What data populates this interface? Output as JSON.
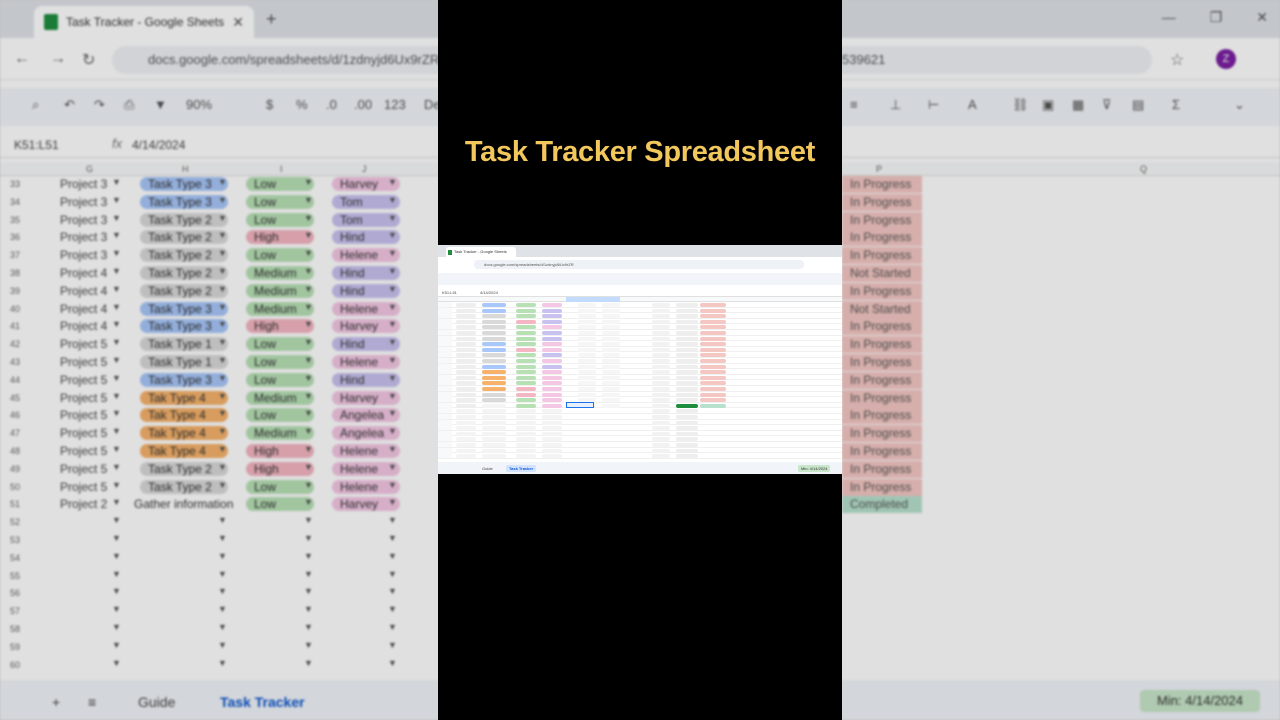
{
  "video": {
    "title": "Task Tracker Spreadsheet"
  },
  "browser": {
    "tab_title": "Task Tracker - Google Sheets",
    "url": "docs.google.com/spreadsheets/d/1zdnyjd6Ux9rZR",
    "url_tail": "539621",
    "profile_initial": "Z"
  },
  "toolbar": {
    "zoom": "90%",
    "currency": "$",
    "percent": "%",
    "dec_decrease": ".0",
    "dec_increase": ".00",
    "number_format": "123",
    "font_short": "De"
  },
  "formula_bar": {
    "name_box": "K51:L51",
    "fx_label": "fx",
    "value": "4/14/2024"
  },
  "columns": {
    "g": "G",
    "h": "H",
    "i": "I",
    "j": "J",
    "p": "P",
    "q": "Q"
  },
  "rows": [
    {
      "n": "33",
      "project": "Project 3",
      "type": "Task Type 3",
      "priority": "Low",
      "owner": "Harvey",
      "status": "In Progress"
    },
    {
      "n": "34",
      "project": "Project 3",
      "type": "Task Type 3",
      "priority": "Low",
      "owner": "Tom",
      "status": "In Progress"
    },
    {
      "n": "35",
      "project": "Project 3",
      "type": "Task Type 2",
      "priority": "Low",
      "owner": "Tom",
      "status": "In Progress"
    },
    {
      "n": "36",
      "project": "Project 3",
      "type": "Task Type 2",
      "priority": "High",
      "owner": "Hind",
      "status": "In Progress"
    },
    {
      "n": "37",
      "project": "Project 3",
      "type": "Task Type 2",
      "priority": "Low",
      "owner": "Helene",
      "status": "In Progress"
    },
    {
      "n": "38",
      "project": "Project 4",
      "type": "Task Type 2",
      "priority": "Medium",
      "owner": "Hind",
      "status": "Not Started"
    },
    {
      "n": "39",
      "project": "Project 4",
      "type": "Task Type 2",
      "priority": "Medium",
      "owner": "Hind",
      "status": "In Progress"
    },
    {
      "n": "40",
      "project": "Project 4",
      "type": "Task Type 3",
      "priority": "Medium",
      "owner": "Helene",
      "status": "Not Started"
    },
    {
      "n": "41",
      "project": "Project 4",
      "type": "Task Type 3",
      "priority": "High",
      "owner": "Harvey",
      "status": "In Progress"
    },
    {
      "n": "42",
      "project": "Project 5",
      "type": "Task Type 1",
      "priority": "Low",
      "owner": "Hind",
      "status": "In Progress"
    },
    {
      "n": "43",
      "project": "Project 5",
      "type": "Task Type 1",
      "priority": "Low",
      "owner": "Helene",
      "status": "In Progress"
    },
    {
      "n": "44",
      "project": "Project 5",
      "type": "Task Type 3",
      "priority": "Low",
      "owner": "Hind",
      "status": "In Progress"
    },
    {
      "n": "45",
      "project": "Project 5",
      "type": "Tak Type 4",
      "priority": "Medium",
      "owner": "Harvey",
      "status": "In Progress"
    },
    {
      "n": "46",
      "project": "Project 5",
      "type": "Tak Type 4",
      "priority": "Low",
      "owner": "Angelea",
      "status": "In Progress"
    },
    {
      "n": "47",
      "project": "Project 5",
      "type": "Tak Type 4",
      "priority": "Medium",
      "owner": "Angelea",
      "status": "In Progress"
    },
    {
      "n": "48",
      "project": "Project 5",
      "type": "Tak Type 4",
      "priority": "High",
      "owner": "Helene",
      "status": "In Progress"
    },
    {
      "n": "49",
      "project": "Project 5",
      "type": "Task Type 2",
      "priority": "High",
      "owner": "Helene",
      "status": "In Progress"
    },
    {
      "n": "50",
      "project": "Project 5",
      "type": "Task Type 2",
      "priority": "Low",
      "owner": "Helene",
      "status": "In Progress"
    },
    {
      "n": "51",
      "project": "Project 2",
      "type": "Gather information",
      "priority": "Low",
      "owner": "Harvey",
      "status": "Completed"
    },
    {
      "n": "52",
      "project": "",
      "type": "",
      "priority": "",
      "owner": "",
      "status": ""
    },
    {
      "n": "53",
      "project": "",
      "type": "",
      "priority": "",
      "owner": "",
      "status": ""
    },
    {
      "n": "54",
      "project": "",
      "type": "",
      "priority": "",
      "owner": "",
      "status": ""
    },
    {
      "n": "55",
      "project": "",
      "type": "",
      "priority": "",
      "owner": "",
      "status": ""
    },
    {
      "n": "56",
      "project": "",
      "type": "",
      "priority": "",
      "owner": "",
      "status": ""
    },
    {
      "n": "57",
      "project": "",
      "type": "",
      "priority": "",
      "owner": "",
      "status": ""
    },
    {
      "n": "58",
      "project": "",
      "type": "",
      "priority": "",
      "owner": "",
      "status": ""
    },
    {
      "n": "59",
      "project": "",
      "type": "",
      "priority": "",
      "owner": "",
      "status": ""
    },
    {
      "n": "60",
      "project": "",
      "type": "",
      "priority": "",
      "owner": "",
      "status": ""
    }
  ],
  "sheet_tabs": {
    "add": "+",
    "menu": "≡",
    "guide": "Guide",
    "tracker": "Task Tracker",
    "summary": "Min: 4/14/2024"
  },
  "colors": {
    "title_yellow": "#f2c75c",
    "panel_black": "#000000",
    "type_blue": "#a8c7fa",
    "type_gray": "#d9d9d9",
    "type_orange": "#f6b26b",
    "pri_low": "#b7e1b5",
    "pri_medium": "#b7e1b5",
    "pri_high": "#f4b6c2",
    "owner_purple": "#c9c2f0",
    "owner_pink": "#f4c7e4",
    "status_red": "#f4c7c3",
    "status_green": "#b7e1cd"
  },
  "icons": [
    "sheets-favicon",
    "close-icon",
    "new-tab-icon",
    "back-icon",
    "forward-icon",
    "reload-icon",
    "site-info-icon",
    "star-icon",
    "search-icon",
    "undo-icon",
    "redo-icon",
    "print-icon",
    "paint-format-icon",
    "dropdown-arrow-icon"
  ]
}
